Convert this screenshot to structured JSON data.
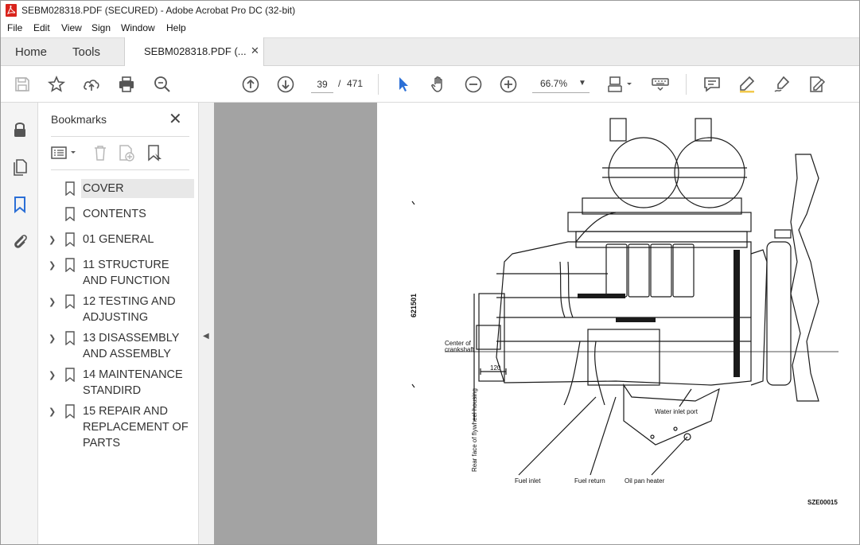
{
  "window": {
    "title": "SEBM028318.PDF (SECURED) - Adobe Acrobat Pro DC (32-bit)"
  },
  "menu": [
    "File",
    "Edit",
    "View",
    "Sign",
    "Window",
    "Help"
  ],
  "tabs": {
    "home": "Home",
    "tools": "Tools",
    "document": "SEBM028318.PDF (...",
    "close_glyph": "✕"
  },
  "toolbar": {
    "page_current": "39",
    "page_separator": "/",
    "page_total": "471",
    "zoom": "66.7%"
  },
  "bookmarks": {
    "title": "Bookmarks",
    "close_glyph": "✕",
    "items": [
      {
        "label": "COVER",
        "expandable": false,
        "selected": true
      },
      {
        "label": "CONTENTS",
        "expandable": false,
        "selected": false
      },
      {
        "label": "01 GENERAL",
        "expandable": true,
        "selected": false
      },
      {
        "label": "11 STRUCTURE AND FUNCTION",
        "expandable": true,
        "selected": false
      },
      {
        "label": "12 TESTING AND ADJUSTING",
        "expandable": true,
        "selected": false
      },
      {
        "label": "13 DISASSEMBLY AND ASSEMBLY",
        "expandable": true,
        "selected": false
      },
      {
        "label": "14 MAINTENANCE STANDIRD",
        "expandable": true,
        "selected": false
      },
      {
        "label": "15 REPAIR AND REPLACEMENT OF PARTS",
        "expandable": true,
        "selected": false
      }
    ]
  },
  "page_content": {
    "doc_id": "621501",
    "center_label_1": "Center of",
    "center_label_2": "crankshaft",
    "dimension": "120",
    "rear_face": "Rear face of flywheel housing",
    "water_inlet": "Water inlet port",
    "fuel_inlet": "Fuel inlet",
    "fuel_return": "Fuel return",
    "oil_pan_heater": "Oil pan heater",
    "figure_code": "SZE00015"
  },
  "colors": {
    "accent_blue": "#2b6fd6",
    "acrobat_red": "#d9231c"
  }
}
